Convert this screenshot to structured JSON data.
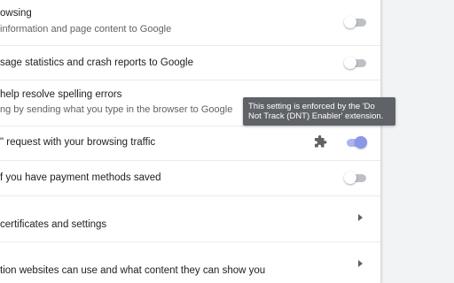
{
  "rows": [
    {
      "primary": "owsing",
      "secondary": "information and page content to Google",
      "control": "toggle",
      "toggle_on": false
    },
    {
      "primary": "sage statistics and crash reports to Google",
      "control": "toggle",
      "toggle_on": false
    },
    {
      "primary": "help resolve spelling errors",
      "secondary": "ng by sending what you type in the browser to Google",
      "control": "toggle",
      "toggle_on": false
    },
    {
      "primary": "\" request with your browsing traffic",
      "control": "toggle",
      "toggle_on": true,
      "disabled": true,
      "extension_icon": "puzzle-piece-icon"
    },
    {
      "primary": "f you have payment methods saved",
      "control": "toggle",
      "toggle_on": false
    },
    {
      "primary": "certificates and settings",
      "control": "arrow"
    },
    {
      "primary": "tion websites can use and what content they can show you",
      "control": "arrow"
    }
  ],
  "tooltip": {
    "line1": "This setting is enforced by the 'Do",
    "line2": "Not Track (DNT) Enabler' extension."
  },
  "colors": {
    "toggle_on_knob": "#8a96ea",
    "toggle_on_track": "#aab4f2",
    "toggle_off_track": "#bdc1c6",
    "tooltip_bg": "#5f6368",
    "background": "#f1f3f4"
  }
}
